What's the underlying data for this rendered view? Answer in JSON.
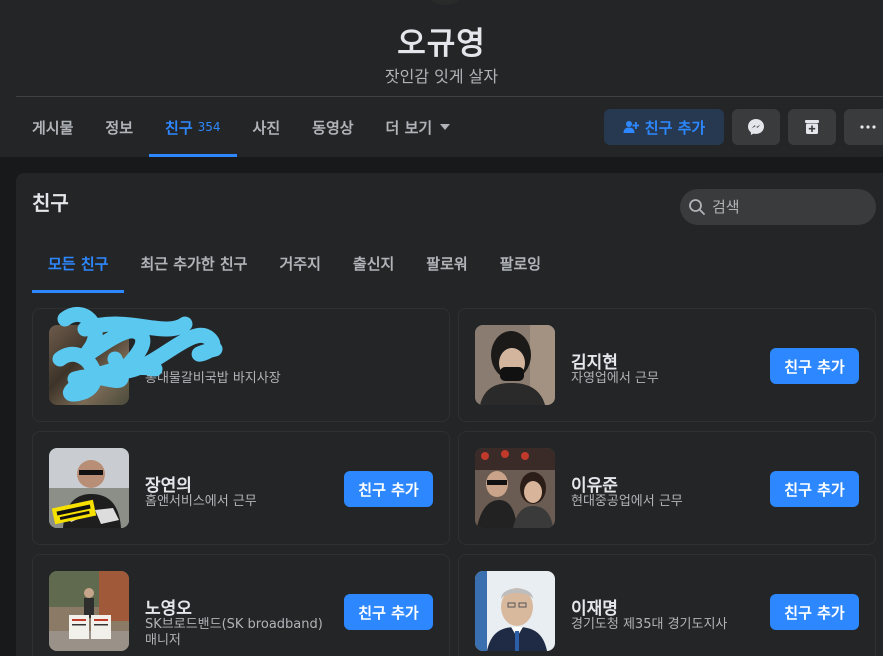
{
  "profile": {
    "name": "오규영",
    "bio": "잣인감 잇게 살자"
  },
  "profile_tabs": [
    {
      "label": "게시물"
    },
    {
      "label": "정보"
    },
    {
      "label": "친구",
      "count": "354"
    },
    {
      "label": "사진"
    },
    {
      "label": "동영상"
    },
    {
      "label": "더 보기"
    }
  ],
  "header_actions": {
    "add_friend_label": "친구 추가"
  },
  "friends_card": {
    "title": "친구",
    "search_placeholder": "검색",
    "tabs": [
      "모든 친구",
      "최근 추가한 친구",
      "거주지",
      "출신지",
      "팔로워",
      "팔로잉"
    ],
    "friends": [
      {
        "name": "",
        "subtitle": "통대물갈비국밥 바지사장",
        "button": ""
      },
      {
        "name": "김지현",
        "subtitle": "자영업에서 근무",
        "button": "친구 추가"
      },
      {
        "name": "장연의",
        "subtitle": "홈앤서비스에서 근무",
        "button": "친구 추가"
      },
      {
        "name": "이유준",
        "subtitle": "현대중공업에서 근무",
        "button": "친구 추가"
      },
      {
        "name": "노영오",
        "subtitle": "SK브로드밴드(SK broadband) 매니저",
        "button": "친구 추가"
      },
      {
        "name": "이재명",
        "subtitle": "경기도청 제35대 경기도지사",
        "button": "친구 추가"
      }
    ]
  },
  "colors": {
    "background": "#18191a",
    "surface": "#242526",
    "accent": "#2d88ff",
    "text_secondary": "#b0b3b8"
  }
}
